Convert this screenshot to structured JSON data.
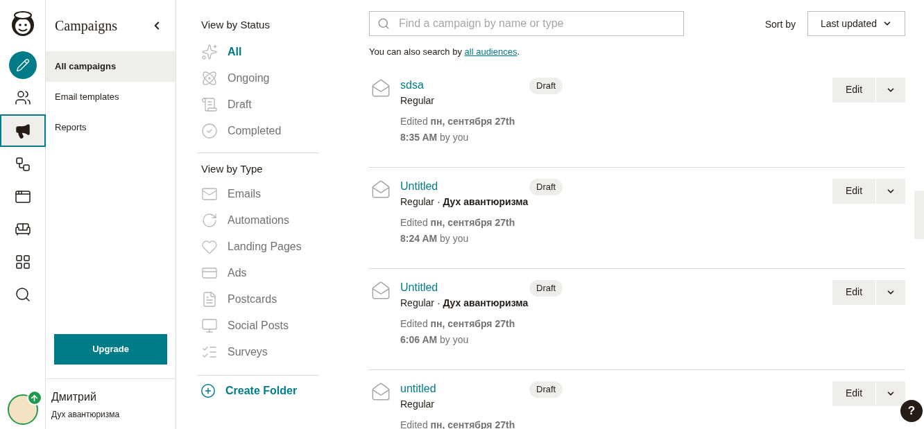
{
  "rail": [
    {
      "kind": "create",
      "selected": false
    },
    {
      "kind": "audience",
      "selected": false
    },
    {
      "kind": "campaigns",
      "selected": true
    },
    {
      "kind": "automations",
      "selected": false
    },
    {
      "kind": "website",
      "selected": false
    },
    {
      "kind": "content",
      "selected": false
    },
    {
      "kind": "integrations",
      "selected": false
    },
    {
      "kind": "search",
      "selected": false
    }
  ],
  "sidebar": {
    "title": "Campaigns",
    "items": [
      {
        "label": "All campaigns",
        "selected": true
      },
      {
        "label": "Email templates",
        "selected": false
      },
      {
        "label": "Reports",
        "selected": false
      }
    ],
    "upgrade_button": "Upgrade",
    "user": {
      "name": "Дмитрий",
      "account": "Дух авантюризма"
    }
  },
  "filters": {
    "status_heading": "View by Status",
    "status": [
      {
        "kind": "all",
        "label": "All",
        "selected": true
      },
      {
        "kind": "ongoing",
        "label": "Ongoing",
        "selected": false
      },
      {
        "kind": "draft",
        "label": "Draft",
        "selected": false
      },
      {
        "kind": "completed",
        "label": "Completed",
        "selected": false
      }
    ],
    "type_heading": "View by Type",
    "types": [
      {
        "kind": "emails",
        "label": "Emails",
        "selected": false
      },
      {
        "kind": "automations",
        "label": "Automations",
        "selected": false
      },
      {
        "kind": "landing",
        "label": "Landing Pages",
        "selected": false
      },
      {
        "kind": "ads",
        "label": "Ads",
        "selected": false
      },
      {
        "kind": "postcards",
        "label": "Postcards",
        "selected": false
      },
      {
        "kind": "social",
        "label": "Social Posts",
        "selected": false
      },
      {
        "kind": "surveys",
        "label": "Surveys",
        "selected": false
      }
    ],
    "create_folder": "Create Folder"
  },
  "search": {
    "placeholder": "Find a campaign by name or type",
    "hint": "You can also search by ",
    "hint_link": "all audiences",
    "hint_end": "."
  },
  "sort": {
    "label": "Sort by",
    "value": "Last updated"
  },
  "campaigns": [
    {
      "name": "sdsa",
      "status": "Draft",
      "meta": "Regular",
      "edited": "Edited **пн, сентября 27th**",
      "time": "**8:35 AM** by you",
      "action": "Edit"
    },
    {
      "name": "Untitled",
      "status": "Draft",
      "meta": "Regular · **Дух авантюризма**",
      "edited": "Edited **пн, сентября 27th**",
      "time": "**8:24 AM** by you",
      "action": "Edit"
    },
    {
      "name": "Untitled",
      "status": "Draft",
      "meta": "Regular · **Дух авантюризма**",
      "edited": "Edited **пн, сентября 27th**",
      "time": "**6:06 AM** by you",
      "action": "Edit"
    },
    {
      "name": "untitled",
      "status": "Draft",
      "meta": "Regular",
      "edited": "Edited **пн, сентября 27th**",
      "action": "Edit"
    }
  ],
  "help_button": "?"
}
